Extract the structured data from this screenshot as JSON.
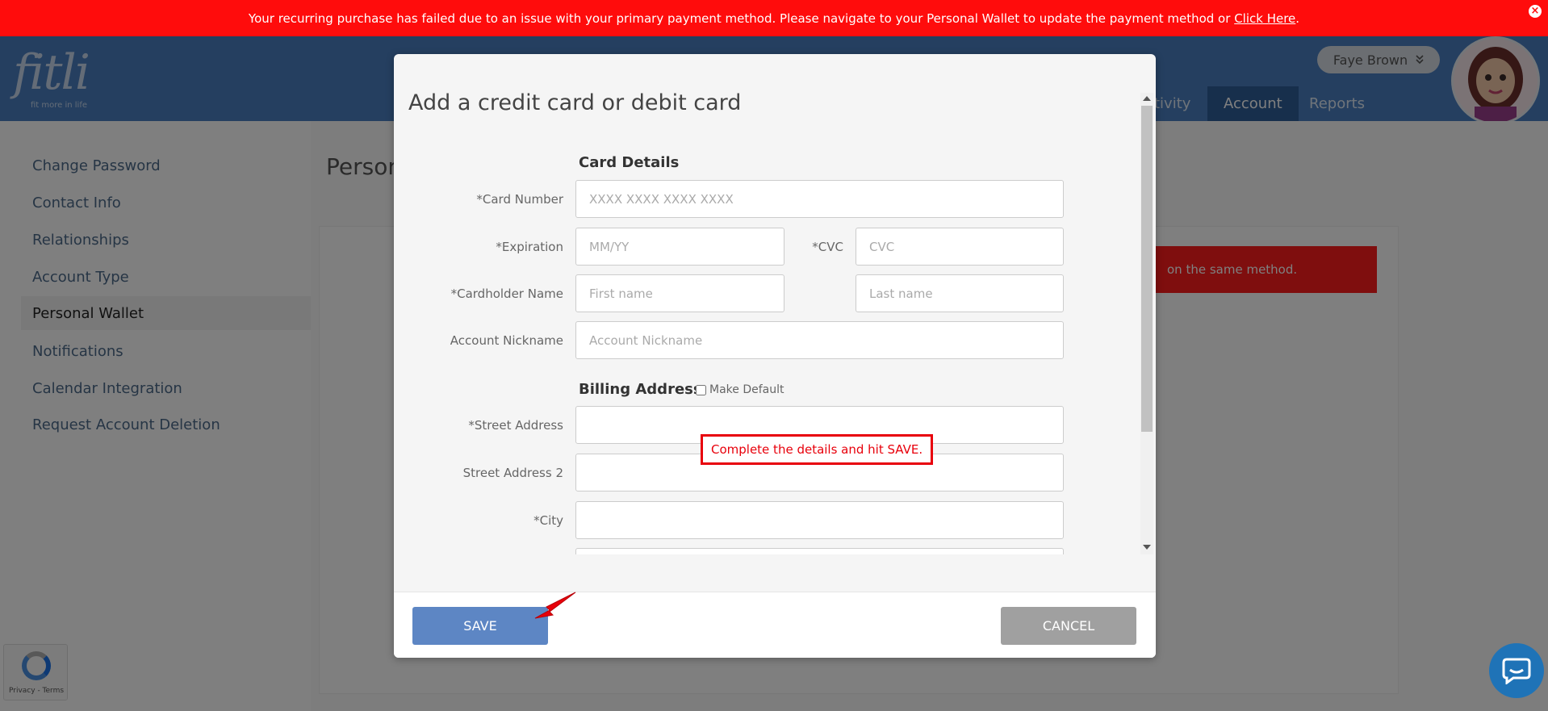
{
  "banner": {
    "message": "Your recurring purchase has failed due to an issue with your primary payment method. Please navigate to your Personal Wallet to update the payment method or",
    "link": "Click Here",
    "link_suffix": "."
  },
  "header": {
    "logo": "fitli",
    "tagline": "fit more in life",
    "nav": [
      {
        "label": "tivity"
      },
      {
        "label": "Account"
      },
      {
        "label": "Reports"
      }
    ],
    "user_name": "Faye Brown"
  },
  "sidebar": {
    "items": [
      {
        "label": "Change Password"
      },
      {
        "label": "Contact Info"
      },
      {
        "label": "Relationships"
      },
      {
        "label": "Account Type"
      },
      {
        "label": "Personal Wallet"
      },
      {
        "label": "Notifications"
      },
      {
        "label": "Calendar Integration"
      },
      {
        "label": "Request Account Deletion"
      }
    ]
  },
  "content": {
    "title": "Persona",
    "error_text": "on the same method."
  },
  "recaptcha": {
    "text": "Privacy - Terms"
  },
  "modal": {
    "title": "Add a credit card or debit card",
    "card_details": {
      "heading": "Card Details",
      "card_number_label": "*Card Number",
      "card_number_placeholder": "XXXX XXXX XXXX XXXX",
      "expiration_label": "*Expiration",
      "expiration_placeholder": "MM/YY",
      "cvc_label": "*CVC",
      "cvc_placeholder": "CVC",
      "cardholder_label": "*Cardholder Name",
      "first_name_placeholder": "First name",
      "last_name_placeholder": "Last name",
      "nickname_label": "Account Nickname",
      "nickname_placeholder": "Account Nickname"
    },
    "billing": {
      "heading": "Billing Address",
      "make_default_label": "Make Default",
      "street_label": "*Street Address",
      "street2_label": "Street Address 2",
      "city_label": "*City"
    },
    "save_label": "SAVE",
    "cancel_label": "CANCEL"
  },
  "callout": {
    "text": "Complete the details and hit SAVE."
  },
  "colors": {
    "banner": "#ff0c0c",
    "header": "#4a7fc1",
    "save_button": "#5d86c4",
    "cancel_button": "#a0a0a0",
    "callout": "#e8000b"
  },
  "icons": {
    "banner_close": "close-circle-icon",
    "user_menu": "chevron-double-down-icon",
    "chat": "chat-bubble-icon",
    "pointer": "red-arrow-icon"
  }
}
